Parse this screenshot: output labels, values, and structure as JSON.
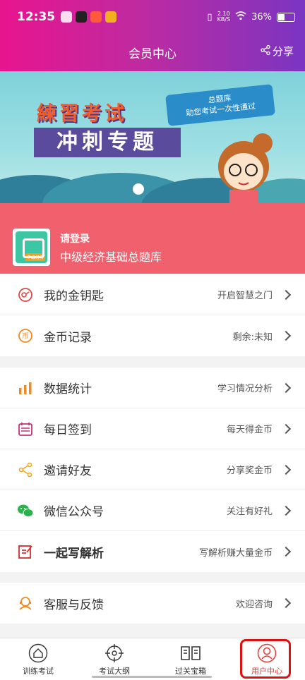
{
  "status_bar": {
    "time": "12:35",
    "net_speed_value": "2.10",
    "net_speed_unit": "KB/S",
    "battery": "36%"
  },
  "header": {
    "title": "会员中心",
    "share_label": "分享"
  },
  "banner": {
    "word1": "練習考试",
    "word2": "冲刺专题",
    "bubble_line1": "总题库",
    "bubble_line2": "助您考试一次性通过"
  },
  "login": {
    "prompt": "请登录",
    "bank_name": "中级经济基础总题库",
    "badge": "中级经济"
  },
  "menu_group1": [
    {
      "label": "我的金钥匙",
      "sub": "开启智慧之门",
      "icon": "key-icon",
      "color": "#e04848"
    },
    {
      "label": "金币记录",
      "sub": "剩余:未知",
      "icon": "coin-icon",
      "color": "#f08a24"
    }
  ],
  "menu_group2": [
    {
      "label": "数据统计",
      "sub": "学习情况分析",
      "icon": "bar-chart-icon",
      "color": "#f08a24"
    },
    {
      "label": "每日签到",
      "sub": "每天得金币",
      "icon": "calendar-icon",
      "color": "#c8307a"
    },
    {
      "label": "邀请好友",
      "sub": "分享奖金币",
      "icon": "share-icon",
      "color": "#f0a820"
    },
    {
      "label": "微信公众号",
      "sub": "关注有好礼",
      "icon": "wechat-icon",
      "color": "#2bb24c"
    },
    {
      "label": "一起写解析",
      "sub": "写解析赚大量金币",
      "icon": "edit-icon",
      "color": "#d03030"
    }
  ],
  "menu_group3": [
    {
      "label": "客服与反馈",
      "sub": "欢迎咨询",
      "icon": "customer-service-icon",
      "color": "#f08a24"
    }
  ],
  "tabs": [
    {
      "label": "训练考试",
      "icon": "home-icon"
    },
    {
      "label": "考试大纲",
      "icon": "target-icon"
    },
    {
      "label": "过关宝箱",
      "icon": "book-icon"
    },
    {
      "label": "用户中心",
      "icon": "user-icon"
    }
  ],
  "colors": {
    "accent": "#e53935",
    "login_bg": "#f1616d"
  }
}
